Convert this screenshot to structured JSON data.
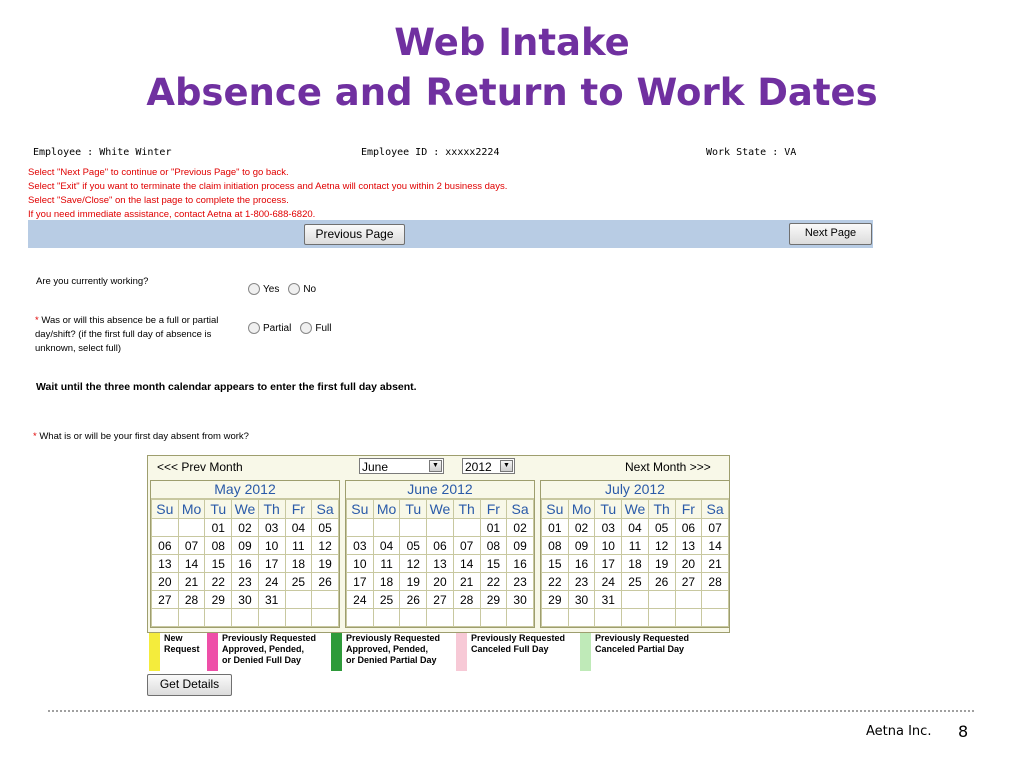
{
  "slide": {
    "title_line1": "Web Intake",
    "title_line2": "Absence and Return to Work Dates",
    "footer_org": "Aetna Inc.",
    "page_number": "8"
  },
  "employee": {
    "name": "Employee : White Winter",
    "id": "Employee ID : xxxxx2224",
    "state": "Work State : VA"
  },
  "instructions": [
    "Select \"Next Page\" to continue or \"Previous Page\" to go back.",
    "Select \"Exit\" if you want to terminate the claim initiation process and Aetna will contact you within 2 business days.",
    "Select \"Save/Close\" on the last page to complete the process.",
    "If you need immediate assistance, contact Aetna at 1-800-688-6820."
  ],
  "nav": {
    "previous": "Previous Page",
    "next": "Next Page"
  },
  "questions": {
    "working": "Are you currently working?",
    "working_yes": "Yes",
    "working_no": "No",
    "partial_star": "*",
    "partial": "Was or will this absence be a full or partial day/shift? (if the first full day of absence is unknown, select full)",
    "partial_opt": "Partial",
    "full_opt": "Full",
    "wait": "Wait until the three month calendar appears to enter the first full day absent.",
    "first_day_star": "*",
    "first_day": "What is or will be your first day absent from work?"
  },
  "calendar": {
    "prev_month": "<<< Prev Month",
    "next_month": "Next Month >>>",
    "month_select": "June",
    "year_select": "2012",
    "weekdays": [
      "Su",
      "Mo",
      "Tu",
      "We",
      "Th",
      "Fr",
      "Sa"
    ],
    "months": [
      {
        "title": "May 2012",
        "rows": [
          [
            "",
            "",
            "01",
            "02",
            "03",
            "04",
            "05"
          ],
          [
            "06",
            "07",
            "08",
            "09",
            "10",
            "11",
            "12"
          ],
          [
            "13",
            "14",
            "15",
            "16",
            "17",
            "18",
            "19"
          ],
          [
            "20",
            "21",
            "22",
            "23",
            "24",
            "25",
            "26"
          ],
          [
            "27",
            "28",
            "29",
            "30",
            "31",
            "",
            ""
          ],
          [
            "",
            "",
            "",
            "",
            "",
            "",
            ""
          ]
        ]
      },
      {
        "title": "June 2012",
        "rows": [
          [
            "",
            "",
            "",
            "",
            "",
            "01",
            "02"
          ],
          [
            "03",
            "04",
            "05",
            "06",
            "07",
            "08",
            "09"
          ],
          [
            "10",
            "11",
            "12",
            "13",
            "14",
            "15",
            "16"
          ],
          [
            "17",
            "18",
            "19",
            "20",
            "21",
            "22",
            "23"
          ],
          [
            "24",
            "25",
            "26",
            "27",
            "28",
            "29",
            "30"
          ],
          [
            "",
            "",
            "",
            "",
            "",
            "",
            ""
          ]
        ]
      },
      {
        "title": "July 2012",
        "rows": [
          [
            "01",
            "02",
            "03",
            "04",
            "05",
            "06",
            "07"
          ],
          [
            "08",
            "09",
            "10",
            "11",
            "12",
            "13",
            "14"
          ],
          [
            "15",
            "16",
            "17",
            "18",
            "19",
            "20",
            "21"
          ],
          [
            "22",
            "23",
            "24",
            "25",
            "26",
            "27",
            "28"
          ],
          [
            "29",
            "30",
            "31",
            "",
            "",
            "",
            ""
          ],
          [
            "",
            "",
            "",
            "",
            "",
            "",
            ""
          ]
        ]
      }
    ]
  },
  "legend": [
    {
      "color": "#f4ec3c",
      "text": "New\nRequest"
    },
    {
      "color": "#ee4fa8",
      "text": "Previously Requested\nApproved, Pended,\nor Denied Full Day"
    },
    {
      "color": "#2e9a3a",
      "text": "Previously Requested\nApproved, Pended,\nor Denied Partial Day"
    },
    {
      "color": "#f7c9d6",
      "text": "Previously Requested\nCanceled Full Day"
    },
    {
      "color": "#bfeab8",
      "text": "Previously Requested\nCanceled Partial Day"
    }
  ],
  "get_details": "Get Details"
}
